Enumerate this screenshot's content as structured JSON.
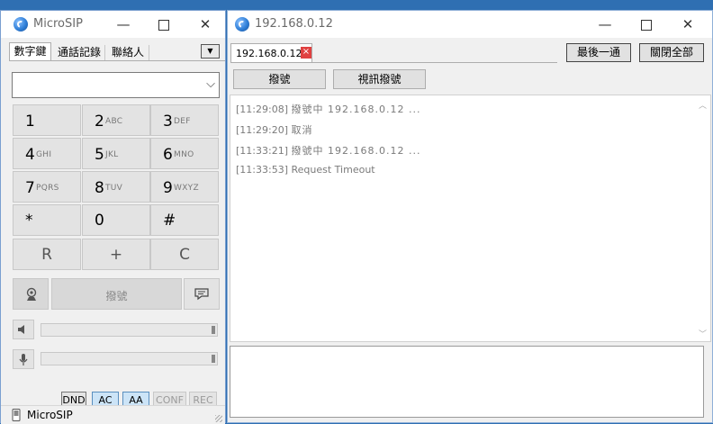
{
  "left_window": {
    "title": "MicroSIP",
    "controls": {
      "minimize": "—",
      "close": "✕"
    },
    "tabs": [
      "數字鍵",
      "通話記錄",
      "聯絡人"
    ],
    "tab_menu_arrow": "▼",
    "number_input": {
      "value": "",
      "dropdown_arrow": "⌵"
    },
    "keypad": [
      {
        "digit": "1",
        "letters": ""
      },
      {
        "digit": "2",
        "letters": "ABC"
      },
      {
        "digit": "3",
        "letters": "DEF"
      },
      {
        "digit": "4",
        "letters": "GHI"
      },
      {
        "digit": "5",
        "letters": "JKL"
      },
      {
        "digit": "6",
        "letters": "MNO"
      },
      {
        "digit": "7",
        "letters": "PQRS"
      },
      {
        "digit": "8",
        "letters": "TUV"
      },
      {
        "digit": "9",
        "letters": "WXYZ"
      },
      {
        "digit": "*",
        "letters": ""
      },
      {
        "digit": "0",
        "letters": ""
      },
      {
        "digit": "#",
        "letters": ""
      }
    ],
    "bottom_keys": [
      "R",
      "+",
      "C"
    ],
    "call_button": "撥號",
    "speaker_volume": 1.0,
    "mic_volume": 1.0,
    "toggles": {
      "dnd": "DND",
      "ac": "AC",
      "aa": "AA",
      "conf": "CONF",
      "rec": "REC"
    },
    "status_bar": "MicroSIP"
  },
  "right_window": {
    "title": "192.168.0.12",
    "controls": {
      "minimize": "—",
      "close": "✕"
    },
    "session_tab": {
      "label": "192.168.0.12",
      "close": "×"
    },
    "buttons": {
      "last_call": "最後一通",
      "close_all": "關閉全部"
    },
    "actions": {
      "dial": "撥號",
      "video_dial": "視訊撥號"
    },
    "log": [
      {
        "time": "[11:29:08]",
        "text": "撥號中 192.168.0.12 ..."
      },
      {
        "time": "[11:29:20]",
        "text": "取消"
      },
      {
        "time": "[11:33:21]",
        "text": "撥號中 192.168.0.12 ..."
      },
      {
        "time": "[11:33:53]",
        "text": "Request Timeout"
      }
    ],
    "message_input": ""
  },
  "colors": {
    "desktop": "#2f6fb2",
    "accent_close_tab": "#e04040",
    "toggle_active": "#cce4f7"
  }
}
